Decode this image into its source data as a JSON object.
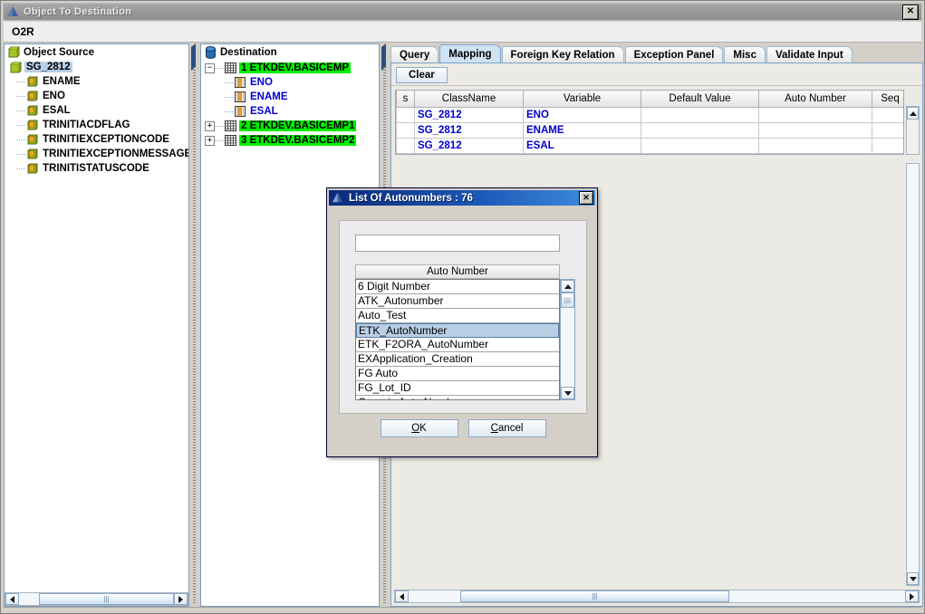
{
  "window": {
    "title": "Object To Destination",
    "icon": "app-triangle-icon",
    "close_label": "✕",
    "subheader": "O2R"
  },
  "object_source": {
    "header": "Object Source",
    "root": {
      "label": "SG_2812",
      "selected": true
    },
    "children": [
      {
        "label": "ENAME"
      },
      {
        "label": "ENO"
      },
      {
        "label": "ESAL"
      },
      {
        "label": "TRINITIACDFLAG"
      },
      {
        "label": "TRINITIEXCEPTIONCODE"
      },
      {
        "label": "TRINITIEXCEPTIONMESSAGE"
      },
      {
        "label": "TRINITISTATUSCODE"
      }
    ]
  },
  "destination": {
    "header": "Destination",
    "nodes": [
      {
        "label": "1 ETKDEV.BASICEMP",
        "expanded": true,
        "handle": "−",
        "children": [
          {
            "label": "ENO"
          },
          {
            "label": "ENAME"
          },
          {
            "label": "ESAL"
          }
        ]
      },
      {
        "label": "2 ETKDEV.BASICEMP1",
        "expanded": false,
        "handle": "+",
        "children": []
      },
      {
        "label": "3 ETKDEV.BASICEMP2",
        "expanded": false,
        "handle": "+",
        "children": []
      }
    ]
  },
  "tabs": [
    {
      "label": "Query",
      "active": false
    },
    {
      "label": "Mapping",
      "active": true
    },
    {
      "label": "Foreign Key Relation",
      "active": false
    },
    {
      "label": "Exception Panel",
      "active": false
    },
    {
      "label": "Misc",
      "active": false
    },
    {
      "label": "Validate Input",
      "active": false
    }
  ],
  "mapping": {
    "clear_button": "Clear",
    "columns": [
      "s",
      "ClassName",
      "Variable",
      "Default Value",
      "Auto Number",
      "Seq"
    ],
    "rows": [
      {
        "s": "",
        "class_name": "SG_2812",
        "variable": "ENO",
        "default_value": "",
        "auto_number": "",
        "seq": "",
        "auto_number_selected": false
      },
      {
        "s": "",
        "class_name": "SG_2812",
        "variable": "ENAME",
        "default_value": "",
        "auto_number": "",
        "seq": "",
        "auto_number_selected": true
      },
      {
        "s": "",
        "class_name": "SG_2812",
        "variable": "ESAL",
        "default_value": "",
        "auto_number": "",
        "seq": "",
        "auto_number_selected": false
      }
    ]
  },
  "dialog": {
    "title": "List Of Autonumbers : 76",
    "close_label": "✕",
    "search_value": "",
    "list_header": "Auto Number",
    "items": [
      {
        "label": "6 Digit Number",
        "selected": false
      },
      {
        "label": "ATK_Autonumber",
        "selected": false
      },
      {
        "label": "Auto_Test",
        "selected": false
      },
      {
        "label": "ETK_AutoNumber",
        "selected": true
      },
      {
        "label": "ETK_F2ORA_AutoNumber",
        "selected": false
      },
      {
        "label": "EXApplication_Creation",
        "selected": false
      },
      {
        "label": "FG Auto",
        "selected": false
      },
      {
        "label": "FG_Lot_ID",
        "selected": false
      },
      {
        "label": "Generic Auto Number",
        "selected": false
      }
    ],
    "ok_button": "OK",
    "ok_mnemonic": "O",
    "ok_rest": "K",
    "cancel_mnemonic": "C",
    "cancel_rest": "ancel",
    "cancel_button": "Cancel"
  },
  "colors": {
    "title_bar": "#9a9a9a",
    "dialog_title": "#1b57b5",
    "selection_blue": "#b8cfe5",
    "tree_green": "#00ee00",
    "value_text": "#0000cc",
    "panel_bg": "#d4d0c8",
    "tab_active": "#cfe3f5"
  }
}
